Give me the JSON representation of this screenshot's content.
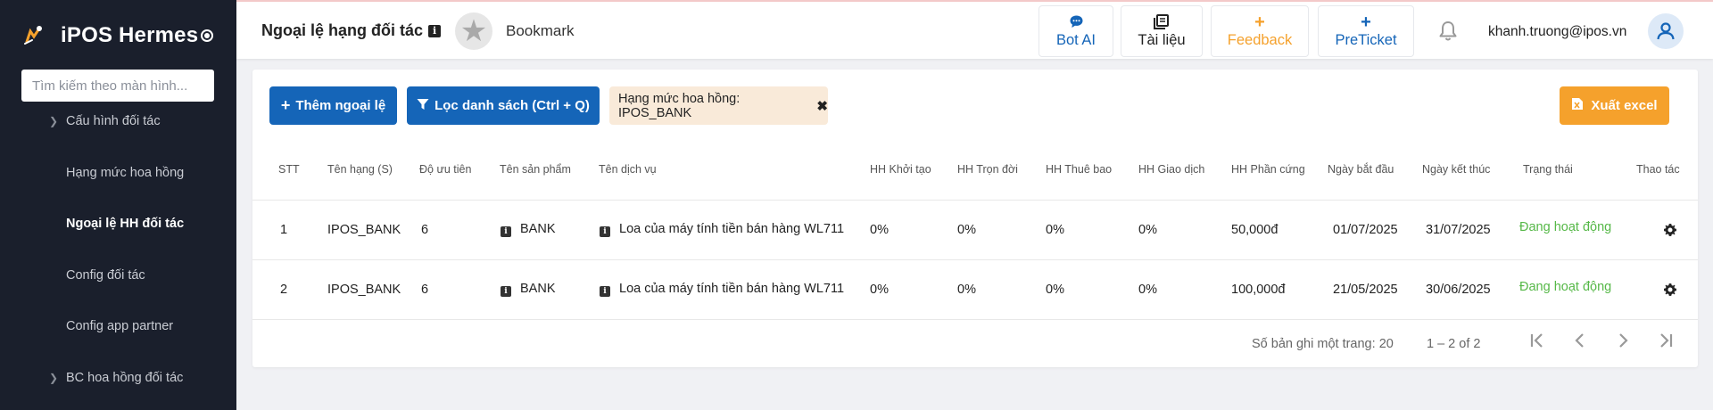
{
  "sidebar": {
    "brand": "iPOS Hermes",
    "search_placeholder": "Tìm kiếm theo màn hình...",
    "items": [
      {
        "label": "Cấu hình đối tác",
        "has_chevron": true,
        "active": false
      },
      {
        "label": "Hạng mức hoa hồng",
        "has_chevron": false,
        "active": false
      },
      {
        "label": "Ngoại lệ HH đối tác",
        "has_chevron": false,
        "active": true
      },
      {
        "label": "Config đối tác",
        "has_chevron": false,
        "active": false
      },
      {
        "label": "Config app partner",
        "has_chevron": false,
        "active": false
      },
      {
        "label": "BC hoa hồng đối tác",
        "has_chevron": true,
        "active": false
      }
    ]
  },
  "topbar": {
    "title": "Ngoại lệ hạng đối tác",
    "bookmark": "Bookmark",
    "buttons": [
      {
        "label": "Bot AI",
        "icon": "chat-icon",
        "color": "#1565b8"
      },
      {
        "label": "Tài liệu",
        "icon": "book-icon",
        "color": "#222222"
      },
      {
        "label": "Feedback",
        "icon": "plus-icon",
        "color": "#f5a12c"
      },
      {
        "label": "PreTicket",
        "icon": "plus-icon",
        "color": "#1565b8"
      }
    ],
    "user_email": "khanh.truong@ipos.vn"
  },
  "toolbar": {
    "add_label": "Thêm ngoại lệ",
    "filter_label": "Lọc danh sách (Ctrl + Q)",
    "chip_label": "Hạng mức hoa hồng: IPOS_BANK",
    "export_label": "Xuất excel"
  },
  "table": {
    "headers": [
      "STT",
      "Tên hạng (S)",
      "Độ ưu tiên",
      "Tên sản phẩm",
      "Tên dịch vụ",
      "HH Khởi tạo",
      "HH Trọn đời",
      "HH Thuê bao",
      "HH Giao dịch",
      "HH Phần cứng",
      "Ngày bắt đầu",
      "Ngày kết thúc",
      "Trạng thái",
      "Thao tác"
    ],
    "rows": [
      {
        "stt": "1",
        "rank": "IPOS_BANK",
        "priority": "6",
        "product": "BANK",
        "service": "Loa của máy tính tiền bán hàng WL711",
        "init": "0%",
        "lifetime": "0%",
        "subscription": "0%",
        "transaction": "0%",
        "hardware": "50,000đ",
        "start": "01/07/2025",
        "end": "31/07/2025",
        "status": "Đang hoạt động"
      },
      {
        "stt": "2",
        "rank": "IPOS_BANK",
        "priority": "6",
        "product": "BANK",
        "service": "Loa của máy tính tiền bán hàng WL711",
        "init": "0%",
        "lifetime": "0%",
        "subscription": "0%",
        "transaction": "0%",
        "hardware": "100,000đ",
        "start": "21/05/2025",
        "end": "30/06/2025",
        "status": "Đang hoạt động"
      }
    ]
  },
  "pagination": {
    "per_page_label": "Số bản ghi một trang:",
    "per_page": "20",
    "range": "1 – 2 of 2"
  },
  "colors": {
    "sidebar_bg": "#1a1f2c",
    "primary": "#1565b8",
    "accent_orange": "#f5a12c",
    "status_active": "#56b848",
    "chip_bg": "#f9ead9"
  }
}
